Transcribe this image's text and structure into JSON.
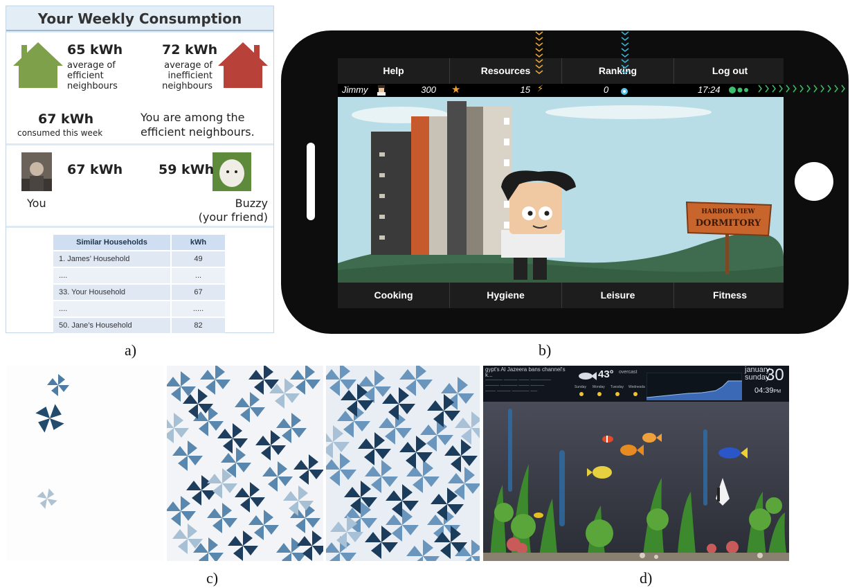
{
  "panel_a": {
    "title": "Your Weekly Consumption",
    "efficient": {
      "value": "65 kWh",
      "label_lines": [
        "average of",
        "efficient",
        "neighbours"
      ],
      "color": "#7ea04a"
    },
    "inefficient": {
      "value": "72 kWh",
      "label_lines": [
        "average of",
        "inefficient",
        "neighbours"
      ],
      "color": "#b8413a"
    },
    "consumed": {
      "value": "67 kWh",
      "label": "consumed this week"
    },
    "message_lines": [
      "You are among the",
      "efficient neighbours."
    ],
    "you": {
      "value": "67 kWh",
      "label": "You"
    },
    "friend": {
      "value": "59 kWh",
      "label_lines": [
        "Buzzy",
        "(your friend)"
      ]
    },
    "table": {
      "headers": [
        "Similar Households",
        "kWh"
      ],
      "rows": [
        [
          "1. James’ Household",
          "49"
        ],
        [
          "....",
          "..."
        ],
        [
          "33. Your Household",
          "67"
        ],
        [
          "....",
          "....."
        ],
        [
          "50. Jane’s Household",
          "82"
        ]
      ]
    }
  },
  "panel_b": {
    "nav_top": [
      "Help",
      "Resources",
      "Ranking",
      "Log out"
    ],
    "nav_bottom": [
      "Cooking",
      "Hygiene",
      "Leisure",
      "Fitness"
    ],
    "status": {
      "user": "Jimmy",
      "points": "300",
      "energy": "15",
      "water": "0",
      "time": "17:24"
    },
    "sign_lines": [
      "HARBOR VIEW",
      "DORMITORY"
    ]
  },
  "panel_d": {
    "temp": "43°",
    "weather": "overcast",
    "month": "january",
    "weekday": "sunday",
    "day": "30",
    "time": "04:39",
    "ampm": "PM",
    "headline": "gypt's Al Jazeera bans channel's k...",
    "forecast_days": [
      "Sunday",
      "Monday",
      "Tuesday",
      "Wednesda"
    ]
  },
  "captions": [
    "a)",
    "b)",
    "c)",
    "d)"
  ]
}
